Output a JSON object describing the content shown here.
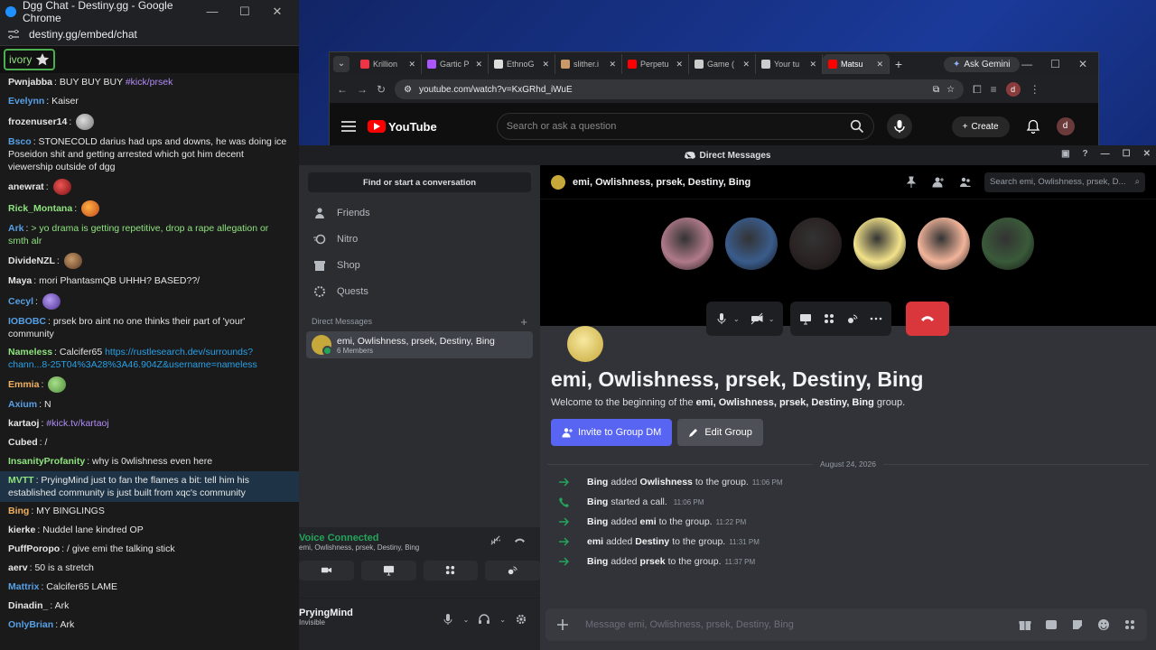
{
  "chat_window": {
    "title": "Dgg Chat - Destiny.gg - Google Chrome",
    "url": "destiny.gg/embed/chat",
    "flair": "ivory",
    "messages": [
      {
        "user": "Pwnjabba",
        "color": "#e6e6e6",
        "text": "BUY BUY BUY ",
        "tag": "#kick/prsek"
      },
      {
        "user": "Evelynn",
        "color": "#56a0e6",
        "text": "Kaiser"
      },
      {
        "user": "frozenuser14",
        "color": "#e6e6e6",
        "text": ""
      },
      {
        "user": "Bsco",
        "color": "#56a0e6",
        "text": "STONECOLD darius had ups and downs, he was doing ice Poseidon shit and getting arrested which got him decent viewership outside of dgg"
      },
      {
        "user": "anewrat",
        "color": "#e6e6e6",
        "text": ""
      },
      {
        "user": "Rick_Montana",
        "color": "#8fe37f",
        "text": ""
      },
      {
        "user": "Ark",
        "color": "#56a0e6",
        "text": "> yo drama is getting repetitive, drop a rape allegation or smth alr",
        "green": true
      },
      {
        "user": "DivideNZL",
        "color": "#e6e6e6",
        "text": ""
      },
      {
        "user": "Maya",
        "color": "#e6e6e6",
        "text": "mori PhantasmQB UHHH? BASED??/"
      },
      {
        "user": "Cecyl",
        "color": "#56a0e6",
        "text": ""
      },
      {
        "user": "IOBOBC",
        "color": "#56a0e6",
        "text": "prsek bro aint no one thinks their part of 'your' community"
      },
      {
        "user": "Nameless",
        "color": "#8fe37f",
        "text": "Calcifer65 ",
        "link": "https://rustlesearch.dev/surrounds?chann...8-25T04%3A28%3A46.904Z&username=nameless"
      },
      {
        "user": "Emmia",
        "color": "#f0b060",
        "text": ""
      },
      {
        "user": "Axium",
        "color": "#56a0e6",
        "text": "N"
      },
      {
        "user": "kartaoj",
        "color": "#e6e6e6",
        "text": "",
        "tag": "#kick.tv/kartaoj"
      },
      {
        "user": "Cubed",
        "color": "#e6e6e6",
        "text": "/"
      },
      {
        "user": "InsanityProfanity",
        "color": "#8fe37f",
        "text": "why is 0wlishness even here"
      },
      {
        "user": "MVTT",
        "color": "#8fe37f",
        "text": "PryingMind just to fan the flames a bit: tell him his established community is just built from xqc's community",
        "highlight": true
      },
      {
        "user": "Bing",
        "color": "#f0b060",
        "text": "MY BINGLINGS"
      },
      {
        "user": "kierke",
        "color": "#e6e6e6",
        "text": "Nuddel lane kindred OP"
      },
      {
        "user": "PuffPoropo",
        "color": "#e6e6e6",
        "text": "/ give emi the talking stick"
      },
      {
        "user": "aerv",
        "color": "#e6e6e6",
        "text": "50 is a stretch"
      },
      {
        "user": "Mattrix",
        "color": "#56a0e6",
        "text": "Calcifer65 LAME"
      },
      {
        "user": "Dinadin_",
        "color": "#e6e6e6",
        "text": "Ark"
      },
      {
        "user": "OnlyBrian",
        "color": "#56a0e6",
        "text": "Ark"
      }
    ]
  },
  "chrome": {
    "tabs": [
      {
        "label": "Krillion",
        "color": "#e34"
      },
      {
        "label": "Gartic P",
        "color": "#a5f"
      },
      {
        "label": "EthnoG",
        "color": "#ddd"
      },
      {
        "label": "slither.i",
        "color": "#c96"
      },
      {
        "label": "Perpetu",
        "color": "#f00"
      },
      {
        "label": "Game (",
        "color": "#ccc"
      },
      {
        "label": "Your tu",
        "color": "#ccc"
      },
      {
        "label": "Matsu",
        "color": "#f00",
        "active": true
      }
    ],
    "gemini": "Ask Gemini",
    "url": "youtube.com/watch?v=KxGRhd_iWuE",
    "profile": "d",
    "youtube": {
      "logo": "YouTube",
      "search_placeholder": "Search or ask a question",
      "create": "Create",
      "avatar": "d"
    }
  },
  "discord": {
    "title": "Direct Messages",
    "find_placeholder": "Find or start a conversation",
    "nav": [
      {
        "label": "Friends",
        "icon": "friends-icon"
      },
      {
        "label": "Nitro",
        "icon": "nitro-icon"
      },
      {
        "label": "Shop",
        "icon": "shop-icon"
      },
      {
        "label": "Quests",
        "icon": "quests-icon"
      }
    ],
    "dm_header": "Direct Messages",
    "dm_group": {
      "name": "emi, Owlishness, prsek, Destiny, Bing",
      "members": "6 Members"
    },
    "voice": {
      "status": "Voice Connected",
      "channel": "emi, Owlishness, prsek, Destiny, Bing"
    },
    "user": {
      "name": "PryingMind",
      "status": "Invisible"
    },
    "header_title": "emi, Owlishness, prsek, Destiny, Bing",
    "search_placeholder": "Search emi, Owlishness, prsek, D...",
    "call_avatars": [
      {
        "name": "fish-avatar",
        "color": "#b07a8a"
      },
      {
        "name": "man-avatar",
        "color": "#3a5c8c"
      },
      {
        "name": "cat-avatar",
        "color": "#2a2222"
      },
      {
        "name": "owl-avatar",
        "color": "#f2e28a"
      },
      {
        "name": "cat-cartoon-avatar",
        "color": "#f2b49a"
      },
      {
        "name": "zombie-avatar",
        "color": "#3a5a3a"
      }
    ],
    "welcome_title": "emi, Owlishness, prsek, Destiny, Bing",
    "welcome_pre": "Welcome to the beginning of the ",
    "welcome_bold": "emi, Owlishness, prsek, Destiny, Bing",
    "welcome_post": " group.",
    "invite_button": "Invite to Group DM",
    "edit_button": "Edit Group",
    "date": "August 24, 2026",
    "events": [
      {
        "icon": "arrow",
        "actor": "Bing",
        "action": "added",
        "target": "Owlishness",
        "rest": "to the group.",
        "time": "11:06 PM"
      },
      {
        "icon": "phone",
        "actor": "Bing",
        "action": "started a call.",
        "target": "",
        "rest": "",
        "time": "11:06 PM"
      },
      {
        "icon": "arrow",
        "actor": "Bing",
        "action": "added",
        "target": "emi",
        "rest": "to the group.",
        "time": "11:22 PM"
      },
      {
        "icon": "arrow",
        "actor": "emi",
        "action": "added",
        "target": "Destiny",
        "rest": "to the group.",
        "time": "11:31 PM"
      },
      {
        "icon": "arrow",
        "actor": "Bing",
        "action": "added",
        "target": "prsek",
        "rest": "to the group.",
        "time": "11:37 PM"
      }
    ],
    "composer_placeholder": "Message emi, Owlishness, prsek, Destiny, Bing",
    "colors": {
      "green": "#23a55a",
      "blurple": "#5865f2",
      "red": "#da373c"
    }
  }
}
